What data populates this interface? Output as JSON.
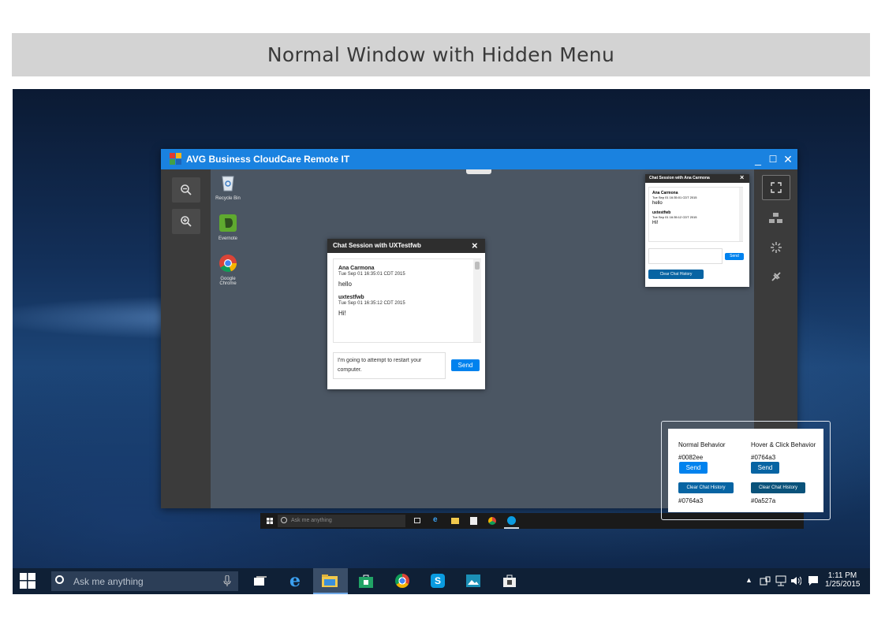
{
  "banner": {
    "title": "Normal Window with Hidden Menu"
  },
  "app": {
    "title": "AVG Business CloudCare Remote IT",
    "controls": {
      "minimize": "_",
      "maximize": "☐",
      "close": "✕"
    }
  },
  "desktop_icons": [
    {
      "label": "Recycle Bin",
      "icon": "recycle-bin-icon"
    },
    {
      "label": "Evernote",
      "icon": "evernote-icon"
    },
    {
      "label": "Google Chrome",
      "icon": "chrome-icon"
    }
  ],
  "left_tools": [
    {
      "icon": "zoom-out-icon"
    },
    {
      "icon": "zoom-in-icon"
    }
  ],
  "right_tools": [
    {
      "icon": "fullscreen-icon"
    },
    {
      "icon": "monitors-icon"
    },
    {
      "icon": "loading-icon"
    },
    {
      "icon": "disconnect-icon"
    }
  ],
  "chat_main": {
    "title": "Chat Session with UXTestfwb",
    "messages": [
      {
        "author": "Ana Carmona",
        "time": "Tue Sep 01 16:35:01 CDT 2015",
        "text": "hello"
      },
      {
        "author": "uxtestfwb",
        "time": "Tue Sep 01 16:35:12 CDT 2015",
        "text": "Hi!"
      }
    ],
    "input_value": "I'm going to attempt to restart your computer.",
    "send_label": "Send"
  },
  "chat_small": {
    "title": "Chat Session with Ana Carmona",
    "messages": [
      {
        "author": "Ana Carmona",
        "time": "Tue Sep 01 16:35:01 CDT 2015",
        "text": "hello"
      },
      {
        "author": "uxtestfwb",
        "time": "Tue Sep 01 16:35:12 CDT 2015",
        "text": "Hi!"
      }
    ],
    "send_label": "Send",
    "clear_label": "Clear Chat History"
  },
  "inner_taskbar": {
    "search_placeholder": "Ask me anything"
  },
  "legend": {
    "normal": {
      "heading": "Normal Behavior",
      "send_color": "#0082ee",
      "send_label": "Send",
      "clear_label": "Clear Chat History",
      "clear_color": "#0764a3"
    },
    "hover": {
      "heading": "Hover & Click Behavior",
      "send_color": "#0764a3",
      "send_label": "Send",
      "clear_label": "Clear Chat History",
      "clear_color": "#0a527a"
    }
  },
  "taskbar": {
    "search_placeholder": "Ask me anything",
    "time": "1:11 PM",
    "date": "1/25/2015"
  }
}
